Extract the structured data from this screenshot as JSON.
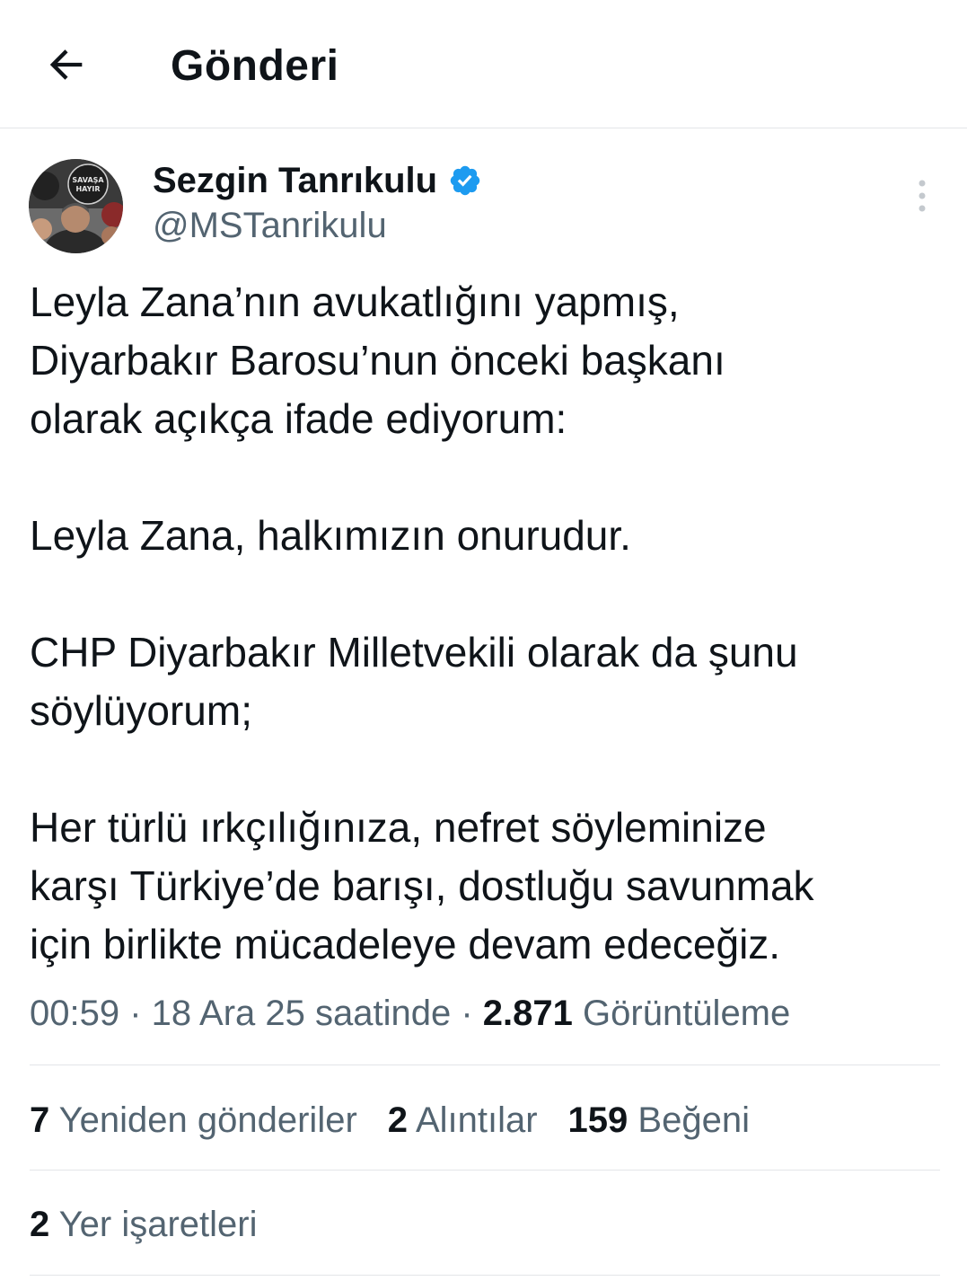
{
  "header": {
    "title": "Gönderi",
    "back_icon": "arrow-left-icon"
  },
  "author": {
    "display_name": "Sezgin Tanrıkulu",
    "handle": "@MSTanrikulu",
    "verified_icon": "verified-badge-icon",
    "verified_color": "#1d9bf0",
    "avatar_sign_text": "SAVAŞA HAYIR"
  },
  "tweet": {
    "text": "Leyla Zana’nın avukatlığını yapmış,\nDiyarbakır Barosu’nun önceki başkanı\nolarak açıkça ifade ediyorum:\n\nLeyla Zana, halkımızın onurudur.\n\nCHP Diyarbakır Milletvekili olarak da şunu\nsöylüyorum;\n\nHer türlü ırkçılığınıza, nefret söyleminize\nkarşı Türkiye’de barışı, dostluğu savunmak\niçin birlikte mücadeleye devam edeceğiz."
  },
  "meta": {
    "time": "00:59",
    "sep1": " · ",
    "date": "18 Ara 25 saatinde",
    "sep2": " · ",
    "views_count": "2.871",
    "views_label": " Görüntüleme"
  },
  "stats": {
    "reposts_count": "7",
    "reposts_label": " Yeniden gönderiler",
    "quotes_count": "2",
    "quotes_label": " Alıntılar",
    "likes_count": "159",
    "likes_label": " Beğeni"
  },
  "bookmarks": {
    "count": "2",
    "label": " Yer işaretleri"
  },
  "colors": {
    "text": "#0f1419",
    "secondary": "#536471",
    "divider": "#e3e5e8"
  }
}
